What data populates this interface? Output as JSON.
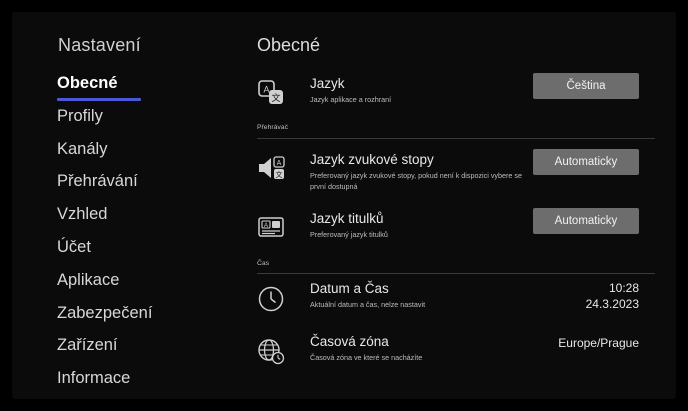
{
  "sidebar": {
    "title": "Nastavení",
    "items": [
      {
        "label": "Obecné",
        "active": true
      },
      {
        "label": "Profily"
      },
      {
        "label": "Kanály"
      },
      {
        "label": "Přehrávání"
      },
      {
        "label": "Vzhled"
      },
      {
        "label": "Účet"
      },
      {
        "label": "Aplikace"
      },
      {
        "label": "Zabezpečení"
      },
      {
        "label": "Zařízení"
      },
      {
        "label": "Informace"
      }
    ]
  },
  "main": {
    "title": "Obecné",
    "language": {
      "icon": "language-translate-icon",
      "title": "Jazyk",
      "description": "Jazyk aplikace a rozhraní",
      "button": "Čeština"
    },
    "player_section": "Přehrávač",
    "audio_language": {
      "icon": "speaker-language-icon",
      "title": "Jazyk zvukové stopy",
      "description": "Preferovaný jazyk zvukové stopy, pokud není k dispozici vybere se první dostupná",
      "button": "Automaticky"
    },
    "subtitle_language": {
      "icon": "subtitles-icon",
      "title": "Jazyk titulků",
      "description": "Preferovaný jazyk titulků",
      "button": "Automaticky"
    },
    "time_section": "Čas",
    "date_time": {
      "icon": "clock-icon",
      "title": "Datum a Čas",
      "description": "Aktuální datum a čas, nelze nastavit",
      "time": "10:28",
      "date": "24.3.2023"
    },
    "timezone": {
      "icon": "globe-clock-icon",
      "title": "Časová zóna",
      "description": "Časová zóna ve které se nacházíte",
      "value": "Europe/Prague"
    }
  },
  "colors": {
    "accent": "#4a57d6",
    "button": "#6d6d6d",
    "background": "#0b0b0b"
  }
}
